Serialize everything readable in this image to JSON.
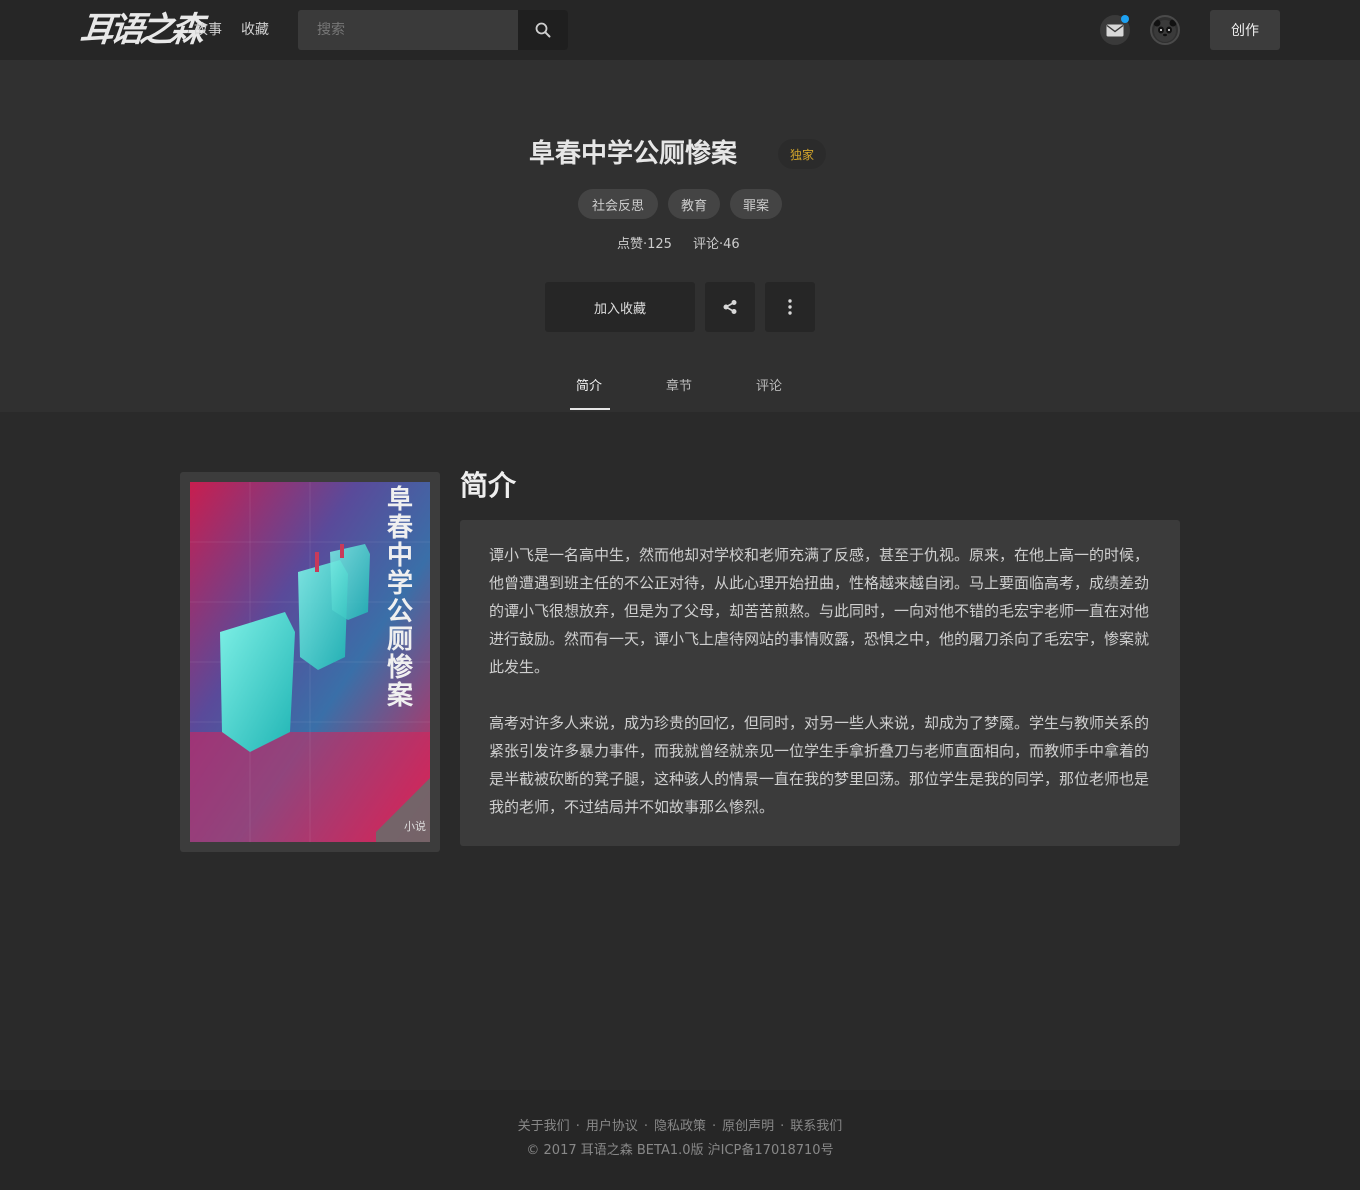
{
  "header": {
    "logo": "耳语之森",
    "nav": [
      "故事",
      "收藏"
    ],
    "search_placeholder": "搜索",
    "create_label": "创作"
  },
  "story": {
    "title": "阜春中学公厕惨案",
    "badge": "独家",
    "tags": [
      "社会反思",
      "教育",
      "罪案"
    ],
    "likes": "点赞·125",
    "comments": "评论·46",
    "favorite_label": "加入收藏"
  },
  "tabs": [
    "简介",
    "章节",
    "评论"
  ],
  "cover": {
    "title_text": "阜春中学公厕惨案",
    "type_label": "小说"
  },
  "intro": {
    "heading": "简介",
    "paragraphs": [
      "谭小飞是一名高中生，然而他却对学校和老师充满了反感，甚至于仇视。原来，在他上高一的时候，他曾遭遇到班主任的不公正对待，从此心理开始扭曲，性格越来越自闭。马上要面临高考，成绩差劲的谭小飞很想放弃，但是为了父母，却苦苦煎熬。与此同时，一向对他不错的毛宏宇老师一直在对他进行鼓励。然而有一天，谭小飞上虐待网站的事情败露，恐惧之中，他的屠刀杀向了毛宏宇，惨案就此发生。",
      "高考对许多人来说，成为珍贵的回忆，但同时，对另一些人来说，却成为了梦魇。学生与教师关系的紧张引发许多暴力事件，而我就曾经就亲见一位学生手拿折叠刀与老师直面相向，而教师手中拿着的是半截被砍断的凳子腿，这种骇人的情景一直在我的梦里回荡。那位学生是我的同学，那位老师也是我的老师，不过结局并不如故事那么惨烈。"
    ]
  },
  "footer": {
    "links": [
      "关于我们",
      "用户协议",
      "隐私政策",
      "原创声明",
      "联系我们"
    ],
    "separator": "·",
    "copyright": "© 2017 耳语之森 BETA1.0版 沪ICP备17018710号"
  },
  "colors": {
    "page_bg": "#2a2a2a",
    "hero_bg": "#303030",
    "topbar_bg": "#262626",
    "badge_text": "#d4a62a",
    "notification_dot": "#1da1f2"
  }
}
